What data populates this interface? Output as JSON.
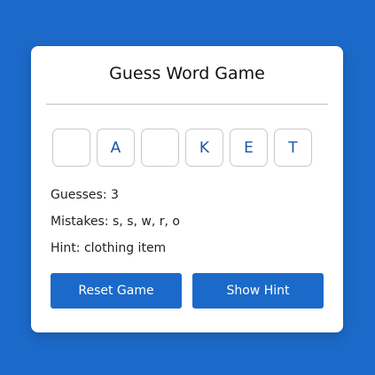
{
  "game": {
    "title": "Guess Word Game",
    "tiles": [
      "",
      "A",
      "",
      "K",
      "E",
      "T"
    ],
    "guesses_label": "Guesses: 3",
    "mistakes_label": "Mistakes: s, s, w, r, o",
    "hint_label": "Hint: clothing item",
    "reset_label": "Reset Game",
    "hint_button_label": "Show Hint"
  },
  "colors": {
    "background": "#1b6ac9",
    "button": "#1b6ac9",
    "letter": "#1b56a8"
  }
}
